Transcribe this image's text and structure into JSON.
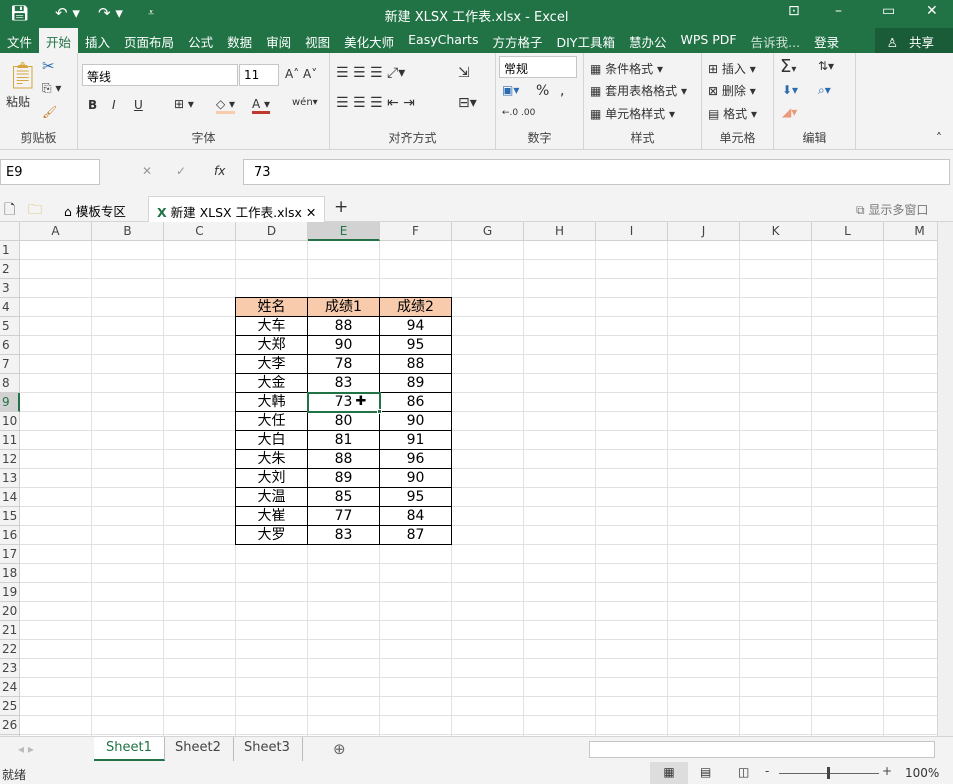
{
  "title": "新建 XLSX 工作表.xlsx - Excel",
  "menu": [
    "文件",
    "开始",
    "插入",
    "页面布局",
    "公式",
    "数据",
    "审阅",
    "视图",
    "美化大师",
    "EasyCharts",
    "方方格子",
    "DIY工具箱",
    "慧办公",
    "WPS PDF"
  ],
  "tell_me": "告诉我...",
  "login": "登录",
  "share": "共享",
  "ribbon": {
    "paste": "粘贴",
    "clipboard": "剪贴板",
    "font_name": "等线",
    "font_size": "11",
    "font": "字体",
    "alignment": "对齐方式",
    "number_format": "常规",
    "number": "数字",
    "cond_format": "条件格式",
    "table_format": "套用表格格式",
    "cell_style": "单元格样式",
    "styles": "样式",
    "insert": "插入",
    "delete": "删除",
    "format": "格式",
    "cells": "单元格",
    "editing": "编辑",
    "bold": "B",
    "italic": "I",
    "underline": "U",
    "percent": "%",
    "comma": ","
  },
  "formula_bar": {
    "name_box": "E9",
    "fx": "fx",
    "value": "73"
  },
  "doc_tabs": {
    "template": "模板专区",
    "file": "新建 XLSX 工作表.xlsx",
    "multi_window": "显示多窗口"
  },
  "columns": [
    "A",
    "B",
    "C",
    "D",
    "E",
    "F",
    "G",
    "H",
    "I",
    "J",
    "K",
    "L",
    "M"
  ],
  "row_count": 27,
  "table": {
    "headers": [
      "姓名",
      "成绩1",
      "成绩2"
    ],
    "rows": [
      [
        "大车",
        "88",
        "94"
      ],
      [
        "大郑",
        "90",
        "95"
      ],
      [
        "大李",
        "78",
        "88"
      ],
      [
        "大金",
        "83",
        "89"
      ],
      [
        "大韩",
        "73",
        "86"
      ],
      [
        "大任",
        "80",
        "90"
      ],
      [
        "大白",
        "81",
        "91"
      ],
      [
        "大朱",
        "88",
        "96"
      ],
      [
        "大刘",
        "89",
        "90"
      ],
      [
        "大温",
        "85",
        "95"
      ],
      [
        "大崔",
        "77",
        "84"
      ],
      [
        "大罗",
        "83",
        "87"
      ]
    ]
  },
  "colors": {
    "header_fill": "#f8cbad",
    "accent": "#217346"
  },
  "sheets": [
    "Sheet1",
    "Sheet2",
    "Sheet3"
  ],
  "status": {
    "ready": "就绪",
    "zoom": "100%"
  }
}
